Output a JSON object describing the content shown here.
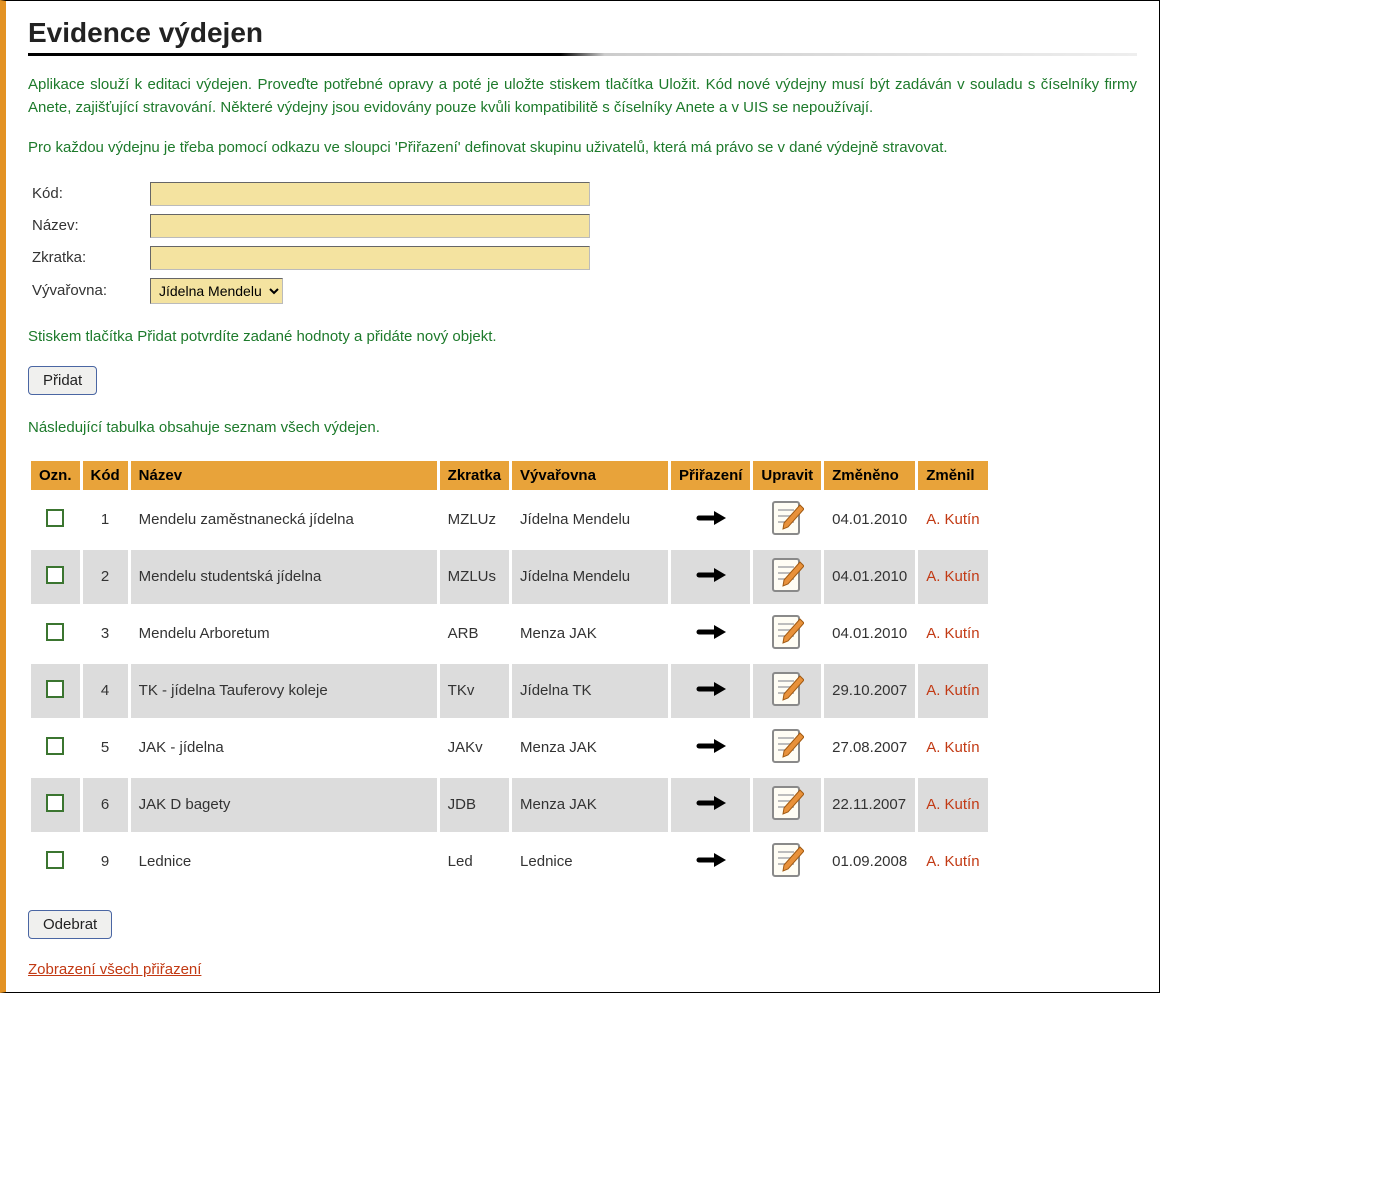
{
  "title": "Evidence výdejen",
  "paragraphs": {
    "p1": "Aplikace slouží k editaci výdejen. Proveďte potřebné opravy a poté je uložte stiskem tlačítka Uložit. Kód nové výdejny musí být zadáván v souladu s číselníky firmy Anete, zajišťující stravování. Některé výdejny jsou evidovány pouze kvůli kompatibilitě s číselníky Anete a v UIS se nepoužívají.",
    "p2": "Pro každou výdejnu je třeba pomocí odkazu ve sloupci 'Přiřazení' definovat skupinu uživatelů, která má právo se v dané výdejně stravovat.",
    "p3": "Stiskem tlačítka Přidat potvrdíte zadané hodnoty a přidáte nový objekt.",
    "p4": "Následující tabulka obsahuje seznam všech výdejen."
  },
  "form": {
    "code_label": "Kód:",
    "name_label": "Název:",
    "abbrev_label": "Zkratka:",
    "kitchen_label": "Vývařovna:",
    "kitchen_selected": "Jídelna Mendelu",
    "code_value": "",
    "name_value": "",
    "abbrev_value": ""
  },
  "buttons": {
    "add": "Přidat",
    "remove": "Odebrat"
  },
  "table": {
    "headers": {
      "mark": "Ozn.",
      "code": "Kód",
      "name": "Název",
      "abbrev": "Zkratka",
      "kitchen": "Vývařovna",
      "assignment": "Přiřazení",
      "edit": "Upravit",
      "changed": "Změněno",
      "changed_by": "Změnil"
    },
    "rows": [
      {
        "code": "1",
        "name": "Mendelu zaměstnanecká jídelna",
        "abbrev": "MZLUz",
        "kitchen": "Jídelna Mendelu",
        "changed": "04.01.2010",
        "changed_by": "A. Kutín"
      },
      {
        "code": "2",
        "name": "Mendelu studentská jídelna",
        "abbrev": "MZLUs",
        "kitchen": "Jídelna Mendelu",
        "changed": "04.01.2010",
        "changed_by": "A. Kutín"
      },
      {
        "code": "3",
        "name": "Mendelu Arboretum",
        "abbrev": "ARB",
        "kitchen": "Menza JAK",
        "changed": "04.01.2010",
        "changed_by": "A. Kutín"
      },
      {
        "code": "4",
        "name": "TK - jídelna Tauferovy koleje",
        "abbrev": "TKv",
        "kitchen": "Jídelna TK",
        "changed": "29.10.2007",
        "changed_by": "A. Kutín"
      },
      {
        "code": "5",
        "name": "JAK - jídelna",
        "abbrev": "JAKv",
        "kitchen": "Menza JAK",
        "changed": "27.08.2007",
        "changed_by": "A. Kutín"
      },
      {
        "code": "6",
        "name": "JAK D bagety",
        "abbrev": "JDB",
        "kitchen": "Menza JAK",
        "changed": "22.11.2007",
        "changed_by": "A. Kutín"
      },
      {
        "code": "9",
        "name": "Lednice",
        "abbrev": "Led",
        "kitchen": "Lednice",
        "changed": "01.09.2008",
        "changed_by": "A. Kutín"
      }
    ]
  },
  "bottom_link": "Zobrazení všech přiřazení"
}
